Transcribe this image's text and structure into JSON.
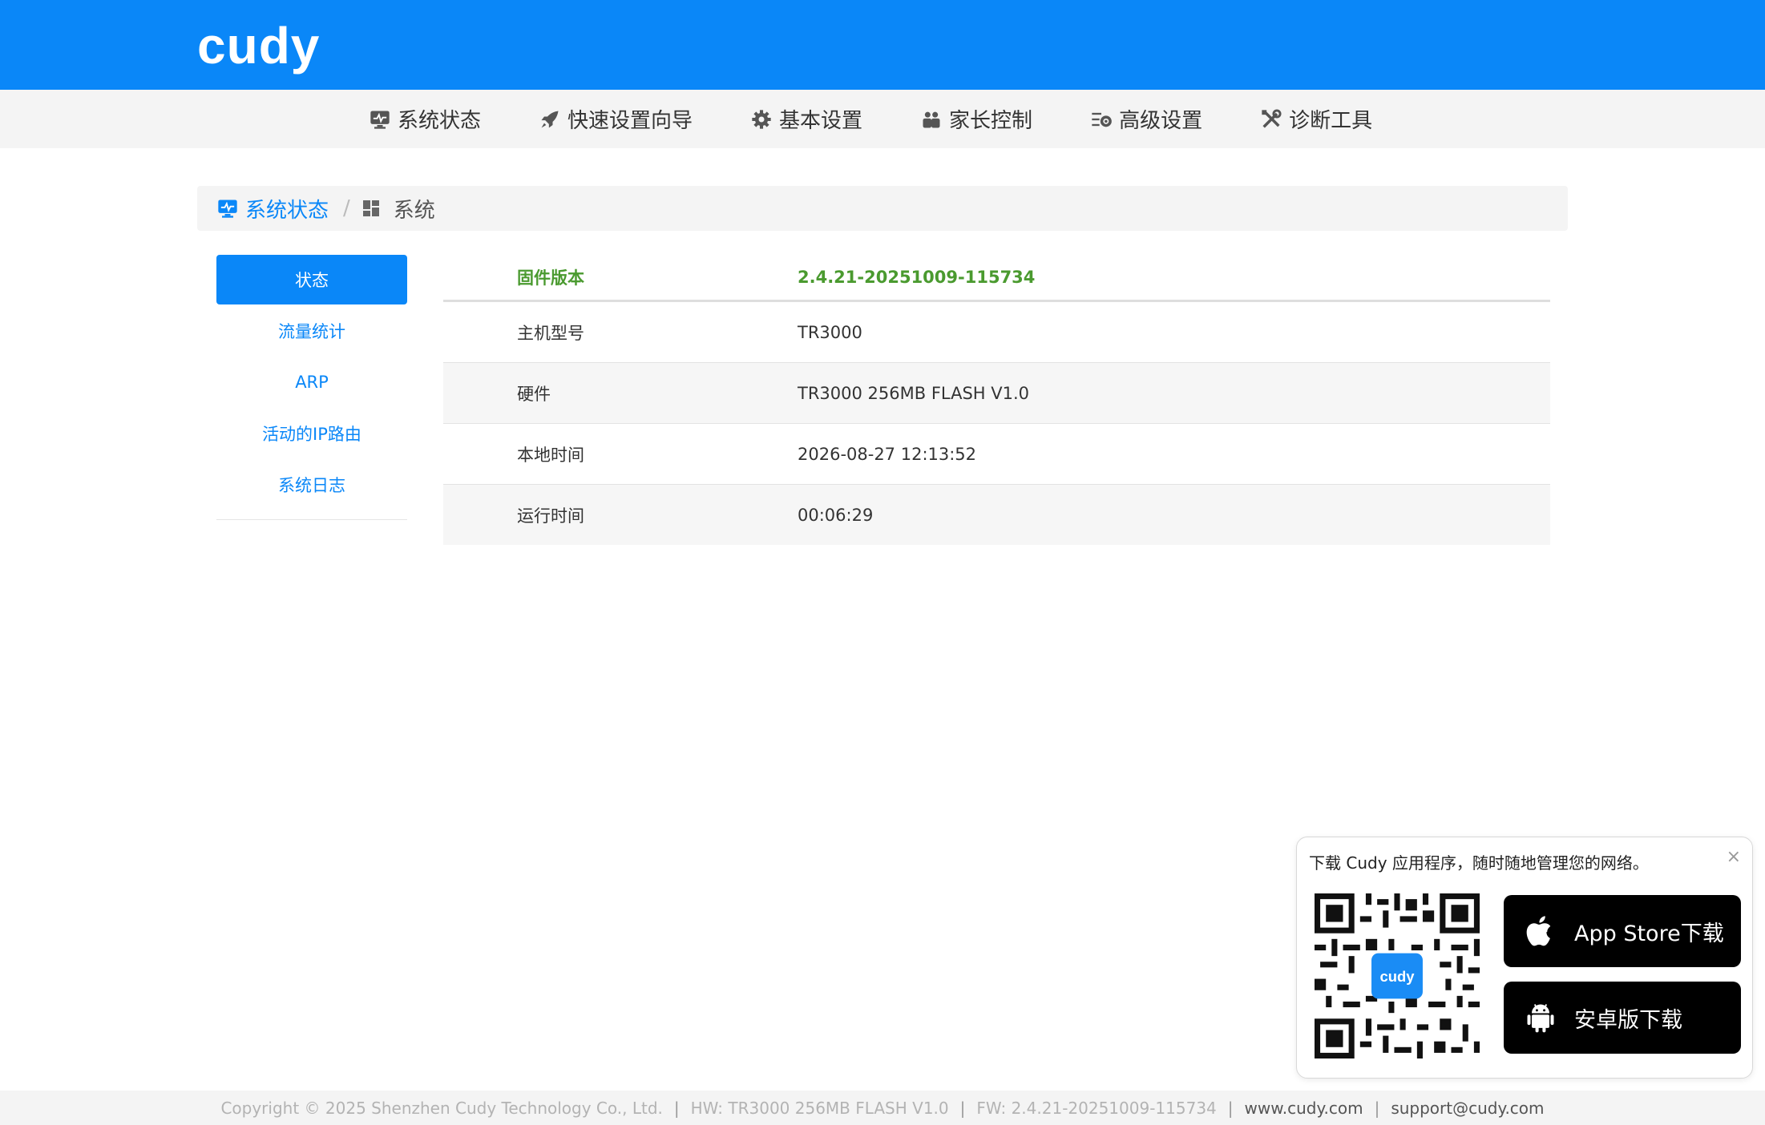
{
  "brand": {
    "logo_text": "cudy",
    "accent": "#0a87f8",
    "highlight": "#4a9a2f"
  },
  "menu": [
    {
      "label": "系统状态",
      "icon": "monitor-icon"
    },
    {
      "label": "快速设置向导",
      "icon": "rocket-icon"
    },
    {
      "label": "基本设置",
      "icon": "gear-icon"
    },
    {
      "label": "家长控制",
      "icon": "users-icon"
    },
    {
      "label": "高级设置",
      "icon": "advanced-settings-icon"
    },
    {
      "label": "诊断工具",
      "icon": "tools-icon"
    }
  ],
  "breadcrumb": {
    "first": "系统状态",
    "separator": "/",
    "second": "系统"
  },
  "sidenav": [
    {
      "label": "状态",
      "active": true
    },
    {
      "label": "流量统计"
    },
    {
      "label": "ARP"
    },
    {
      "label": "活动的IP路由"
    },
    {
      "label": "系统日志"
    }
  ],
  "table": {
    "header": {
      "key": "固件版本",
      "value": "2.4.21-20251009-115734"
    },
    "rows": [
      {
        "key": "主机型号",
        "value": "TR3000"
      },
      {
        "key": "硬件",
        "value": "TR3000 256MB FLASH V1.0"
      },
      {
        "key": "本地时间",
        "value": "2026-08-27 12:13:52"
      },
      {
        "key": "运行时间",
        "value": "00:06:29"
      }
    ]
  },
  "popup": {
    "title": "下载 Cudy 应用程序，随时随地管理您的网络。",
    "close": "×",
    "qr_logo": "cudy",
    "app_store": "App Store下载",
    "android": "安卓版下载"
  },
  "footer": {
    "copyright": "Copyright © 2025 Shenzhen Cudy Technology Co., Ltd.",
    "hw": "HW: TR3000 256MB FLASH V1.0",
    "fw": "FW: 2.4.21-20251009-115734",
    "website": "www.cudy.com",
    "email": "support@cudy.com",
    "separator": "|"
  }
}
